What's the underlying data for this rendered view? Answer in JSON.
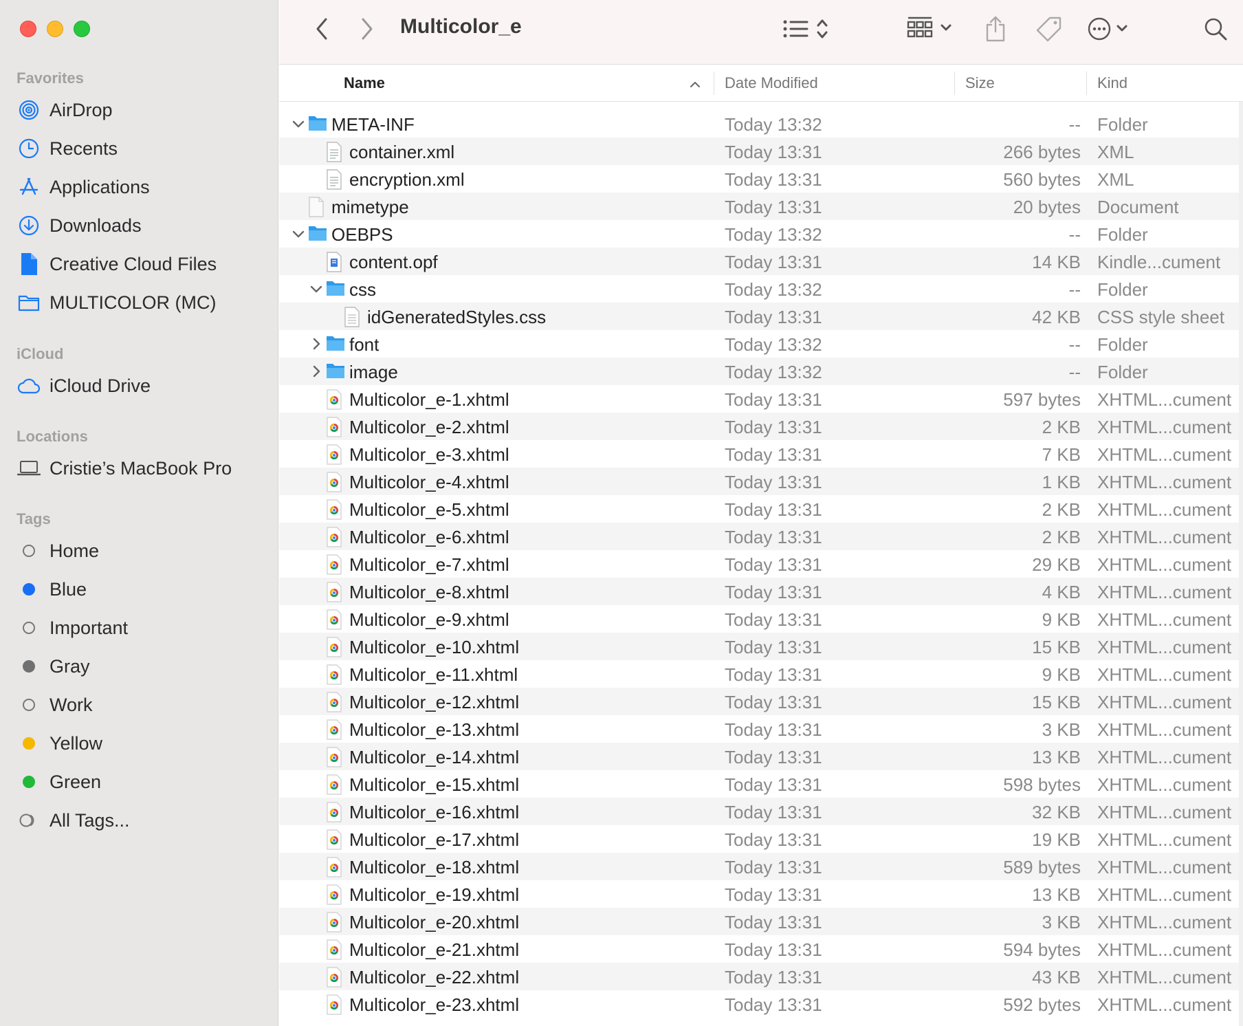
{
  "window": {
    "title": "Multicolor_e"
  },
  "colors": {
    "accent": "#1a7cf5",
    "folder": "#35a8f0",
    "sidebar_bg": "#e9e6e6",
    "toolbar_bg": "#fbf4f4"
  },
  "sidebar": {
    "favorites_label": "Favorites",
    "favorites": [
      {
        "label": "AirDrop",
        "icon": "airdrop-icon"
      },
      {
        "label": "Recents",
        "icon": "clock-icon"
      },
      {
        "label": "Applications",
        "icon": "applications-icon"
      },
      {
        "label": "Downloads",
        "icon": "download-icon"
      },
      {
        "label": "Creative Cloud Files",
        "icon": "document-icon"
      },
      {
        "label": "MULTICOLOR (MC)",
        "icon": "folder-icon"
      }
    ],
    "icloud_label": "iCloud",
    "icloud": [
      {
        "label": "iCloud Drive",
        "icon": "cloud-icon"
      }
    ],
    "locations_label": "Locations",
    "locations": [
      {
        "label": "Cristie’s MacBook Pro",
        "icon": "laptop-icon"
      }
    ],
    "tags_label": "Tags",
    "tags": [
      {
        "label": "Home",
        "color": "none"
      },
      {
        "label": "Blue",
        "color": "#1a6ef5"
      },
      {
        "label": "Important",
        "color": "none"
      },
      {
        "label": "Gray",
        "color": "#707070"
      },
      {
        "label": "Work",
        "color": "none"
      },
      {
        "label": "Yellow",
        "color": "#f5b800"
      },
      {
        "label": "Green",
        "color": "#1fba3a"
      },
      {
        "label": "All Tags...",
        "color": "all"
      }
    ]
  },
  "columns": {
    "name": "Name",
    "date": "Date Modified",
    "size": "Size",
    "kind": "Kind"
  },
  "files": [
    {
      "name": "META-INF",
      "date": "Today 13:32",
      "size": "--",
      "kind": "Folder",
      "type": "folder",
      "level": 0,
      "disclosure": "open"
    },
    {
      "name": "container.xml",
      "date": "Today 13:31",
      "size": "266 bytes",
      "kind": "XML",
      "type": "xml",
      "level": 1,
      "disclosure": ""
    },
    {
      "name": "encryption.xml",
      "date": "Today 13:31",
      "size": "560 bytes",
      "kind": "XML",
      "type": "xml",
      "level": 1,
      "disclosure": ""
    },
    {
      "name": "mimetype",
      "date": "Today 13:31",
      "size": "20 bytes",
      "kind": "Document",
      "type": "blank",
      "level": 0,
      "disclosure": ""
    },
    {
      "name": "OEBPS",
      "date": "Today 13:32",
      "size": "--",
      "kind": "Folder",
      "type": "folder",
      "level": 0,
      "disclosure": "open"
    },
    {
      "name": "content.opf",
      "date": "Today 13:31",
      "size": "14 KB",
      "kind": "Kindle...cument",
      "type": "opf",
      "level": 1,
      "disclosure": ""
    },
    {
      "name": "css",
      "date": "Today 13:32",
      "size": "--",
      "kind": "Folder",
      "type": "folder",
      "level": 1,
      "disclosure": "open"
    },
    {
      "name": "idGeneratedStyles.css",
      "date": "Today 13:31",
      "size": "42 KB",
      "kind": "CSS style sheet",
      "type": "css",
      "level": 2,
      "disclosure": ""
    },
    {
      "name": "font",
      "date": "Today 13:32",
      "size": "--",
      "kind": "Folder",
      "type": "folder",
      "level": 1,
      "disclosure": "closed"
    },
    {
      "name": "image",
      "date": "Today 13:32",
      "size": "--",
      "kind": "Folder",
      "type": "folder",
      "level": 1,
      "disclosure": "closed"
    },
    {
      "name": "Multicolor_e-1.xhtml",
      "date": "Today 13:31",
      "size": "597 bytes",
      "kind": "XHTML...cument",
      "type": "xhtml",
      "level": 1,
      "disclosure": ""
    },
    {
      "name": "Multicolor_e-2.xhtml",
      "date": "Today 13:31",
      "size": "2 KB",
      "kind": "XHTML...cument",
      "type": "xhtml",
      "level": 1,
      "disclosure": ""
    },
    {
      "name": "Multicolor_e-3.xhtml",
      "date": "Today 13:31",
      "size": "7 KB",
      "kind": "XHTML...cument",
      "type": "xhtml",
      "level": 1,
      "disclosure": ""
    },
    {
      "name": "Multicolor_e-4.xhtml",
      "date": "Today 13:31",
      "size": "1 KB",
      "kind": "XHTML...cument",
      "type": "xhtml",
      "level": 1,
      "disclosure": ""
    },
    {
      "name": "Multicolor_e-5.xhtml",
      "date": "Today 13:31",
      "size": "2 KB",
      "kind": "XHTML...cument",
      "type": "xhtml",
      "level": 1,
      "disclosure": ""
    },
    {
      "name": "Multicolor_e-6.xhtml",
      "date": "Today 13:31",
      "size": "2 KB",
      "kind": "XHTML...cument",
      "type": "xhtml",
      "level": 1,
      "disclosure": ""
    },
    {
      "name": "Multicolor_e-7.xhtml",
      "date": "Today 13:31",
      "size": "29 KB",
      "kind": "XHTML...cument",
      "type": "xhtml",
      "level": 1,
      "disclosure": ""
    },
    {
      "name": "Multicolor_e-8.xhtml",
      "date": "Today 13:31",
      "size": "4 KB",
      "kind": "XHTML...cument",
      "type": "xhtml",
      "level": 1,
      "disclosure": ""
    },
    {
      "name": "Multicolor_e-9.xhtml",
      "date": "Today 13:31",
      "size": "9 KB",
      "kind": "XHTML...cument",
      "type": "xhtml",
      "level": 1,
      "disclosure": ""
    },
    {
      "name": "Multicolor_e-10.xhtml",
      "date": "Today 13:31",
      "size": "15 KB",
      "kind": "XHTML...cument",
      "type": "xhtml",
      "level": 1,
      "disclosure": ""
    },
    {
      "name": "Multicolor_e-11.xhtml",
      "date": "Today 13:31",
      "size": "9 KB",
      "kind": "XHTML...cument",
      "type": "xhtml",
      "level": 1,
      "disclosure": ""
    },
    {
      "name": "Multicolor_e-12.xhtml",
      "date": "Today 13:31",
      "size": "15 KB",
      "kind": "XHTML...cument",
      "type": "xhtml",
      "level": 1,
      "disclosure": ""
    },
    {
      "name": "Multicolor_e-13.xhtml",
      "date": "Today 13:31",
      "size": "3 KB",
      "kind": "XHTML...cument",
      "type": "xhtml",
      "level": 1,
      "disclosure": ""
    },
    {
      "name": "Multicolor_e-14.xhtml",
      "date": "Today 13:31",
      "size": "13 KB",
      "kind": "XHTML...cument",
      "type": "xhtml",
      "level": 1,
      "disclosure": ""
    },
    {
      "name": "Multicolor_e-15.xhtml",
      "date": "Today 13:31",
      "size": "598 bytes",
      "kind": "XHTML...cument",
      "type": "xhtml",
      "level": 1,
      "disclosure": ""
    },
    {
      "name": "Multicolor_e-16.xhtml",
      "date": "Today 13:31",
      "size": "32 KB",
      "kind": "XHTML...cument",
      "type": "xhtml",
      "level": 1,
      "disclosure": ""
    },
    {
      "name": "Multicolor_e-17.xhtml",
      "date": "Today 13:31",
      "size": "19 KB",
      "kind": "XHTML...cument",
      "type": "xhtml",
      "level": 1,
      "disclosure": ""
    },
    {
      "name": "Multicolor_e-18.xhtml",
      "date": "Today 13:31",
      "size": "589 bytes",
      "kind": "XHTML...cument",
      "type": "xhtml",
      "level": 1,
      "disclosure": ""
    },
    {
      "name": "Multicolor_e-19.xhtml",
      "date": "Today 13:31",
      "size": "13 KB",
      "kind": "XHTML...cument",
      "type": "xhtml",
      "level": 1,
      "disclosure": ""
    },
    {
      "name": "Multicolor_e-20.xhtml",
      "date": "Today 13:31",
      "size": "3 KB",
      "kind": "XHTML...cument",
      "type": "xhtml",
      "level": 1,
      "disclosure": ""
    },
    {
      "name": "Multicolor_e-21.xhtml",
      "date": "Today 13:31",
      "size": "594 bytes",
      "kind": "XHTML...cument",
      "type": "xhtml",
      "level": 1,
      "disclosure": ""
    },
    {
      "name": "Multicolor_e-22.xhtml",
      "date": "Today 13:31",
      "size": "43 KB",
      "kind": "XHTML...cument",
      "type": "xhtml",
      "level": 1,
      "disclosure": ""
    },
    {
      "name": "Multicolor_e-23.xhtml",
      "date": "Today 13:31",
      "size": "592 bytes",
      "kind": "XHTML...cument",
      "type": "xhtml",
      "level": 1,
      "disclosure": ""
    }
  ]
}
